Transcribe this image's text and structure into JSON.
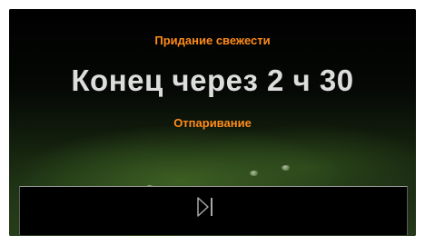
{
  "display": {
    "program_name": "Придание свежести",
    "time_remaining": "Конец через 2 ч 30",
    "current_phase": "Отпаривание"
  },
  "controls": {
    "skip_icon": "skip-next-icon"
  },
  "colors": {
    "accent": "#ff8c1a",
    "primary_text": "#dddddd",
    "background": "#000000"
  }
}
